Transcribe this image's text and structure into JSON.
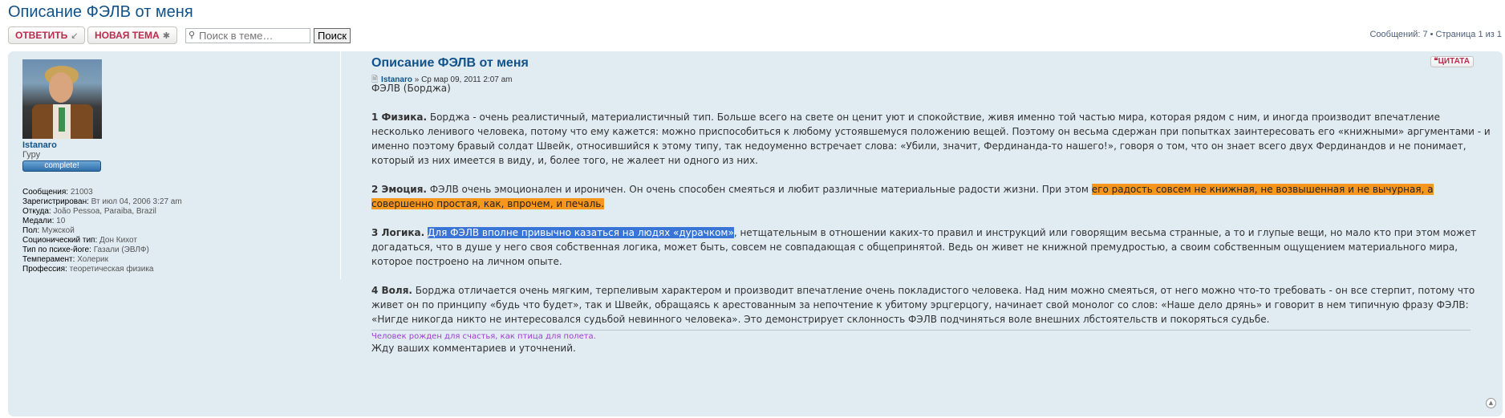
{
  "topic": {
    "title": "Описание ФЭЛВ от меня"
  },
  "toolbar": {
    "reply_label": "ОТВЕТИТЬ",
    "reply_icon": "↙",
    "new_topic_label": "НОВАЯ ТЕМА",
    "new_topic_icon": "✱",
    "search_placeholder": "Поиск в теме…",
    "search_button": "Поиск",
    "pagination": "Сообщений: 7 • Страница 1 из 1"
  },
  "author": {
    "name": "Istanaro",
    "rank": "Гуру",
    "badge": "complete!",
    "profile": [
      {
        "label": "Сообщения:",
        "value": "21003"
      },
      {
        "label": "Зарегистрирован:",
        "value": "Вт июл 04, 2006 3:27 am"
      },
      {
        "label": "Откуда:",
        "value": "João Pessoa, Paraiba, Brazil"
      },
      {
        "label": "Медали:",
        "value": "10"
      },
      {
        "label": "Пол:",
        "value": "Мужской"
      },
      {
        "label": "Соционический тип:",
        "value": "Дон Кихот"
      },
      {
        "label": "Тип по психе-йоге:",
        "value": "Газали (ЭВЛФ)"
      },
      {
        "label": "Темперамент:",
        "value": "Холерик"
      },
      {
        "label": "Профессия:",
        "value": "теоретическая физика"
      }
    ]
  },
  "post": {
    "title": "Описание ФЭЛВ от меня",
    "quote_label": "ЦИТАТА",
    "author": "Istanaro",
    "date": "» Ср мар 09, 2011 2:07 am",
    "intro": "ФЭЛВ (Борджа)",
    "p1_head": "1 Физика.",
    "p1_text": " Борджа - очень реалистичный, материалистичный тип. Больше всего на свете он ценит уют и спокойствие, живя именно той частью мира, которая рядом с ним, и иногда производит впечатление несколько ленивого человека, потому что ему кажется: можно приспособиться к любому устоявшемуся положению вещей. Поэтому он весьма сдержан при попытках заинтересовать его «книжными» аргументами - и именно поэтому бравый солдат Швейк, относившийся к этому типу, так недоуменно встречает слова: «Убили, значит, Фердинанда-то нашего!», говоря о том, что он знает всего двух Фердинандов и не понимает, который из них имеется в виду, и, более того, не жалеет ни одного из них.",
    "p2_head": "2 Эмоция.",
    "p2_text": " ФЭЛВ очень эмоционален и ироничен. Он очень способен смеяться и любит различные материальные радости жизни. При этом ",
    "p2_highlight": "его радость совсем не книжная, не возвышенная и не вычурная, а совершенно простая, как, впрочем, и печаль.",
    "p3_head": "3 Логика.",
    "p3_highlight": "Для ФЭЛВ вполне привычно казаться на людях «дурачком»",
    "p3_text": ", нетщательным в отношении каких-то правил и инструкций или говорящим весьма странные, а то и глупые вещи, но мало кто при этом может догадаться, что в душе у него своя собственная логика, может быть, совсем не совпадающая с общепринятой. Ведь он живет не книжной премудростью, а своим собственным ощущением материального мира, которое построено на личном опыте.",
    "p4_head": "4 Воля.",
    "p4_text": " Борджа отличается очень мягким, терпеливым характером и производит впечатление очень покладистого человека. Над ним можно смеяться, от него можно что-то требовать - он все стерпит, потому что живет он по принципу «будь что будет», так и Швейк, обращаясь к арестованным за непочтение к убитому эрцгерцогу, начинает свой монолог со слов: «Наше дело дрянь» и говорит в нем типичную фразу ФЭЛВ: «Нигде никогда никто не интересовался судьбой невинного человека». Это демонстрирует склонность ФЭЛВ подчиняться воле внешних лбстоятельств и покоряться судьбе.",
    "closing": "Жду ваших комментариев и уточнений.",
    "signature": "Человек рожден для счастья, как птица для полета."
  },
  "colors": {
    "link": "#105289",
    "button_text": "#bc2a4d",
    "post_bg": "#e1ebf2",
    "highlight_orange": "#f7961d",
    "highlight_blue": "#3875d7",
    "signature": "#9d3ed0"
  },
  "icons": [
    "reply-arrow-icon",
    "new-topic-star-icon",
    "search-icon",
    "quote-icon",
    "post-document-icon",
    "back-to-top-icon"
  ]
}
